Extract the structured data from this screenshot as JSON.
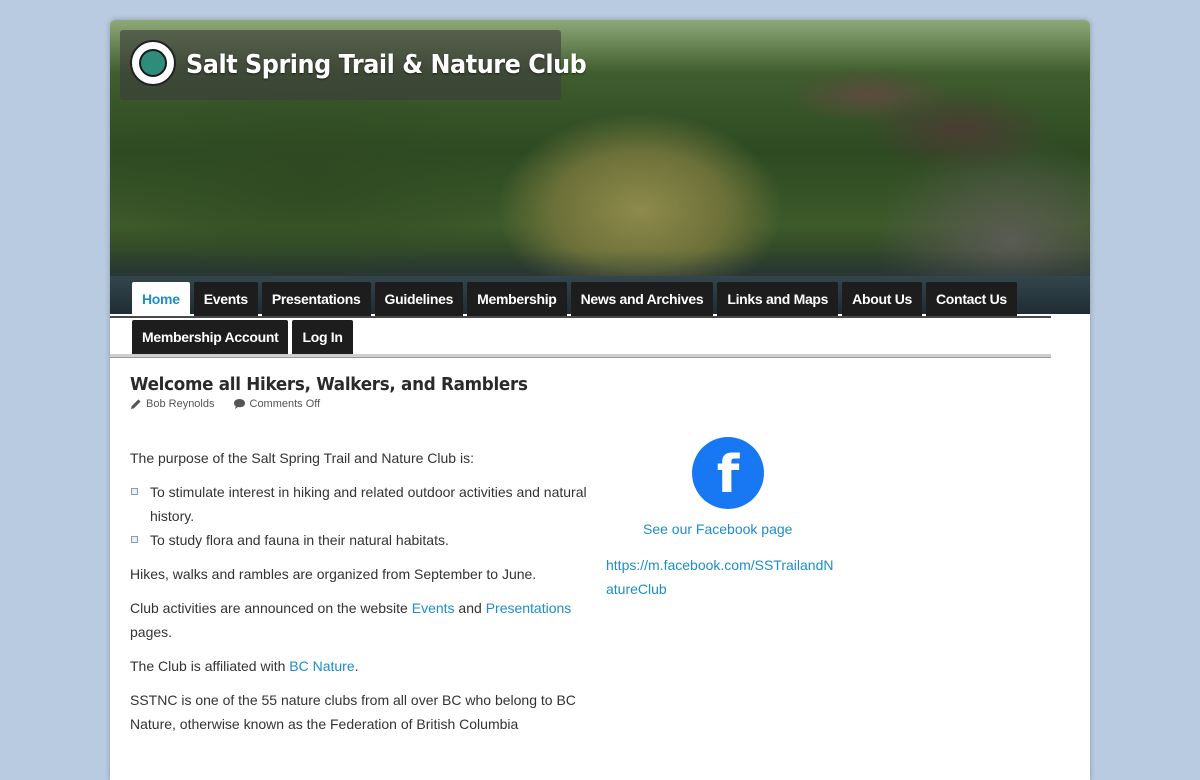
{
  "site": {
    "title": "Salt Spring Trail & Nature Club",
    "logo_icon": "club-logo-icon"
  },
  "nav": {
    "row1": [
      "Home",
      "Events",
      "Presentations",
      "Guidelines",
      "Membership",
      "News and Archives",
      "Links and Maps",
      "About Us",
      "Contact Us"
    ],
    "row2": [
      "Membership Account",
      "Log In"
    ],
    "active": "Home"
  },
  "post": {
    "title": "Welcome all Hikers, Walkers, and Ramblers",
    "author": "Bob Reynolds",
    "comments": "Comments Off",
    "intro": "The purpose of the Salt Spring Trail and Nature Club is:",
    "bullets": [
      "To stimulate interest in hiking and related outdoor activities and natural history.",
      "To study flora and fauna in their natural habitats."
    ],
    "p_schedule": "Hikes, walks and rambles are organized from September to June.",
    "p_activities_pre": "Club activities are announced on the website ",
    "p_activities_link1": "Events",
    "p_activities_mid": " and ",
    "p_activities_link2": "Presentations",
    "p_activities_post": " pages.",
    "p_affiliated_pre": "The Club is affiliated with ",
    "p_affiliated_link": "BC Nature",
    "p_affiliated_post": ".",
    "p_sstnc": "SSTNC is one of the 55 nature clubs from all over BC who belong to BC Nature, otherwise known as the Federation of British Columbia"
  },
  "sidebar": {
    "fb_icon": "facebook-icon",
    "fb_glyph": "f",
    "fb_caption": "See our Facebook page",
    "fb_url": "https://m.facebook.com/SSTrailandNatureClub"
  },
  "colors": {
    "background": "#b9cbe0",
    "link": "#1e8dc8",
    "nav_tab": "#1d1d1d",
    "facebook": "#1877f2"
  }
}
